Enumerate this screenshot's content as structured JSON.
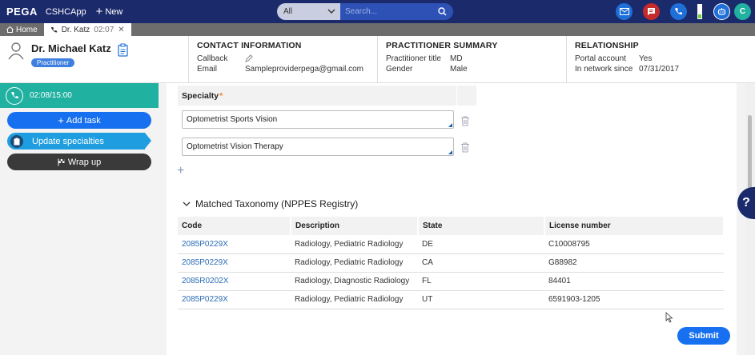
{
  "topbar": {
    "logo": "PEGA",
    "app_name": "CSHCApp",
    "new_label": "New",
    "search_scope": "All",
    "search_placeholder": "Search...",
    "avatar_letter": "C",
    "icons": [
      "email-icon",
      "chat-icon",
      "phone-icon",
      "battery-icon",
      "assistant-icon",
      "avatar"
    ]
  },
  "tabs": {
    "home_label": "Home",
    "active_label": "Dr. Katz",
    "active_time": "02:07"
  },
  "contact": {
    "name": "Dr. Michael Katz",
    "role": "Practitioner",
    "section_title": "CONTACT INFORMATION",
    "callback_label": "Callback",
    "email_label": "Email",
    "email_value": "Sampleproviderpega@gmail.com"
  },
  "summary": {
    "section_title": "PRACTITIONER SUMMARY",
    "title_label": "Practitioner title",
    "title_value": "MD",
    "gender_label": "Gender",
    "gender_value": "Male"
  },
  "relationship": {
    "section_title": "RELATIONSHIP",
    "portal_label": "Portal account",
    "portal_value": "Yes",
    "network_label": "In network since",
    "network_value": "07/31/2017"
  },
  "sidebar": {
    "call_timer": "02:08/15:00",
    "add_task": "Add task",
    "update_specialties": "Update specialties",
    "wrap_up": "Wrap up"
  },
  "specialty": {
    "header": "Specialty",
    "required_mark": "*",
    "items": [
      "Optometrist Sports Vision",
      "Optometrist Vision Therapy"
    ],
    "add_symbol": "+"
  },
  "taxonomy": {
    "title": "Matched Taxonomy (NPPES Registry)",
    "columns": [
      "Code",
      "Description",
      "State",
      "License number"
    ],
    "rows": [
      [
        "2085P0229X",
        "Radiology, Pediatric Radiology",
        "DE",
        "C10008795"
      ],
      [
        "2085P0229X",
        "Radiology, Pediatric Radiology",
        "CA",
        "G88982"
      ],
      [
        "2085R0202X",
        "Radiology, Diagnostic Radiology",
        "FL",
        "84401"
      ],
      [
        "2085P0229X",
        "Radiology, Pediatric Radiology",
        "UT",
        "6591903-1205"
      ]
    ]
  },
  "actions": {
    "submit": "Submit",
    "help": "?"
  },
  "colors": {
    "topbar": "#1b2a6b",
    "accent": "#1670f0",
    "call_bar": "#20b1a0",
    "link": "#2a6bb5"
  }
}
